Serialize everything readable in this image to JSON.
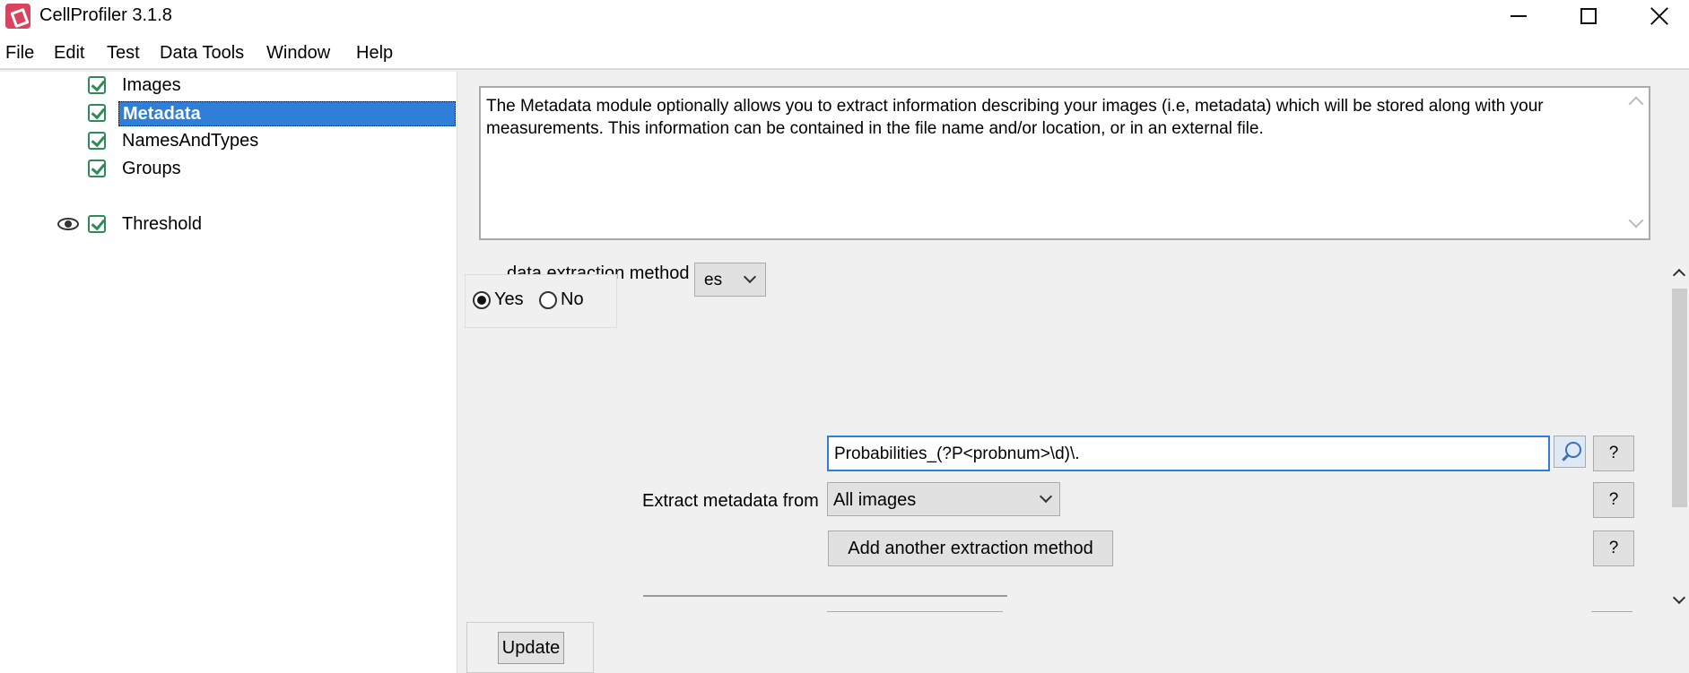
{
  "window": {
    "title": "CellProfiler 3.1.8",
    "accent": "#d9435f"
  },
  "menu": [
    "File",
    "Edit",
    "Test",
    "Data Tools",
    "Window",
    "Help"
  ],
  "pipeline": {
    "items": [
      {
        "label": "Images",
        "enabled": true,
        "selected": false
      },
      {
        "label": "Metadata",
        "enabled": true,
        "selected": true
      },
      {
        "label": "NamesAndTypes",
        "enabled": true,
        "selected": false
      },
      {
        "label": "Groups",
        "enabled": true,
        "selected": false
      },
      {
        "label": "Threshold",
        "enabled": true,
        "selected": false,
        "show_eye": true
      }
    ],
    "selected_color": "#2f7fd8"
  },
  "help": {
    "text": "The Metadata module optionally allows you to extract information describing your images (i.e, metadata) which will be stored along with your measurements. This information can be contained in the file name and/or location, or in an external file."
  },
  "settings": {
    "method_label": "data extraction method",
    "method_combo_value": "es",
    "radio": {
      "yes_label": "Yes",
      "no_label": "No",
      "selected": "Yes"
    },
    "regex_value": "Probabilities_(?P<probnum>\\d)\\.",
    "extract_from_label": "Extract metadata from",
    "extract_from_value": "All images",
    "add_method_label": "Add another extraction method",
    "help_label": "?"
  },
  "footer": {
    "update_label": "Update"
  }
}
